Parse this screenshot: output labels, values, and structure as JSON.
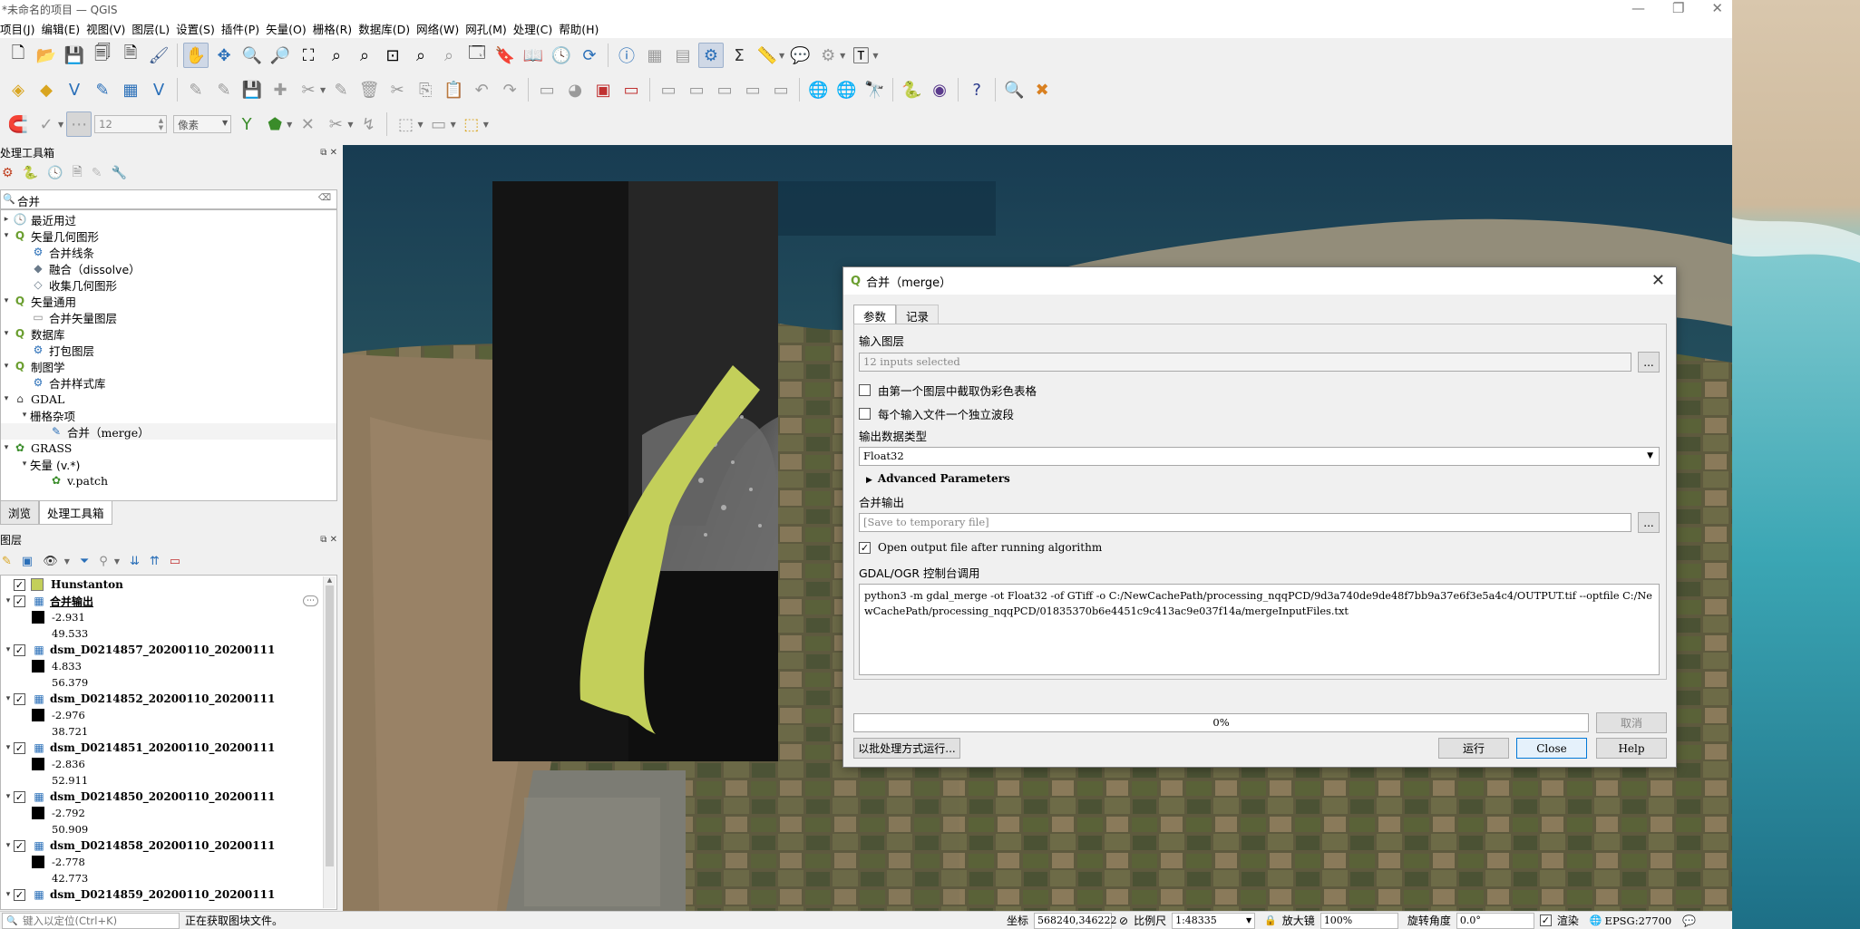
{
  "window": {
    "title": "*未命名的项目 — QGIS"
  },
  "menu": [
    "项目(J)",
    "编辑(E)",
    "视图(V)",
    "图层(L)",
    "设置(S)",
    "插件(P)",
    "矢量(O)",
    "栅格(R)",
    "数据库(D)",
    "网络(W)",
    "网孔(M)",
    "处理(C)",
    "帮助(H)"
  ],
  "digitize_toolbar": {
    "snap_value": "12",
    "snap_unit": "像素"
  },
  "toolbox": {
    "title": "处理工具箱",
    "search_value": "合并",
    "tree": [
      {
        "label": "最近用过",
        "level": 0,
        "icon": "clock-icon",
        "caret": "▸"
      },
      {
        "label": "矢量几何图形",
        "level": 0,
        "icon": "qgis-icon",
        "caret": "▾"
      },
      {
        "label": "合并线条",
        "level": 1,
        "icon": "gear-icon",
        "caret": ""
      },
      {
        "label": "融合（dissolve）",
        "level": 1,
        "icon": "dissolve-icon",
        "caret": ""
      },
      {
        "label": "收集几何图形",
        "level": 1,
        "icon": "collect-icon",
        "caret": ""
      },
      {
        "label": "矢量通用",
        "level": 0,
        "icon": "qgis-icon",
        "caret": "▾"
      },
      {
        "label": "合并矢量图层",
        "level": 1,
        "icon": "merge-vector-icon",
        "caret": ""
      },
      {
        "label": "数据库",
        "level": 0,
        "icon": "qgis-icon",
        "caret": "▾"
      },
      {
        "label": "打包图层",
        "level": 1,
        "icon": "gear-icon",
        "caret": ""
      },
      {
        "label": "制图学",
        "level": 0,
        "icon": "qgis-icon",
        "caret": "▾"
      },
      {
        "label": "合并样式库",
        "level": 1,
        "icon": "gear-icon",
        "caret": ""
      },
      {
        "label": "GDAL",
        "level": 0,
        "icon": "gdal-icon",
        "caret": "▾"
      },
      {
        "label": "栅格杂项",
        "level": 1,
        "icon": "",
        "caret": "▾"
      },
      {
        "label": "合并（merge）",
        "level": 2,
        "icon": "merge-raster-icon",
        "caret": ""
      },
      {
        "label": "GRASS",
        "level": 0,
        "icon": "grass-icon",
        "caret": "▾"
      },
      {
        "label": "矢量 (v.*)",
        "level": 1,
        "icon": "",
        "caret": "▾"
      },
      {
        "label": "v.patch",
        "level": 2,
        "icon": "grass-icon",
        "caret": ""
      }
    ],
    "tabs": [
      "浏览",
      "处理工具箱"
    ]
  },
  "layers": {
    "title": "图层",
    "items": [
      {
        "name": "Hunstanton",
        "type": "polygon",
        "color": "#c3cf5a",
        "underline": false
      },
      {
        "name": "合并输出",
        "type": "raster",
        "min": "-2.931",
        "max": "49.533",
        "underline": true
      },
      {
        "name": "dsm_D0214857_20200110_20200111",
        "type": "raster",
        "min": "4.833",
        "max": "56.379",
        "underline": false
      },
      {
        "name": "dsm_D0214852_20200110_20200111",
        "type": "raster",
        "min": "-2.976",
        "max": "38.721",
        "underline": false
      },
      {
        "name": "dsm_D0214851_20200110_20200111",
        "type": "raster",
        "min": "-2.836",
        "max": "52.911",
        "underline": false
      },
      {
        "name": "dsm_D0214850_20200110_20200111",
        "type": "raster",
        "min": "-2.792",
        "max": "50.909",
        "underline": false
      },
      {
        "name": "dsm_D0214858_20200110_20200111",
        "type": "raster",
        "min": "-2.778",
        "max": "42.773",
        "underline": false
      },
      {
        "name": "dsm_D0214859_20200110_20200111",
        "type": "raster",
        "min": "",
        "max": "",
        "underline": false
      }
    ]
  },
  "dialog": {
    "title": "合并（merge）",
    "tabs": [
      "参数",
      "记录"
    ],
    "input_layers_label": "输入图层",
    "input_layers_value": "12 inputs selected",
    "browse_label": "...",
    "chk_pct_label": "由第一个图层中截取伪彩色表格",
    "chk_separate_label": "每个输入文件一个独立波段",
    "data_type_label": "输出数据类型",
    "data_type_value": "Float32",
    "advanced_label": "Advanced Parameters",
    "output_label": "合并输出",
    "output_placeholder": "[Save to temporary file]",
    "browse2_label": "...",
    "open_output_label": "Open output file after running algorithm",
    "console_label": "GDAL/OGR 控制台调用",
    "console_text": "python3 -m gdal_merge -ot Float32 -of GTiff -o C:/NewCachePath/processing_nqqPCD/9d3a740de9de48f7bb9a37e6f3e5a4c4/OUTPUT.tif --optfile C:/NewCachePath/processing_nqqPCD/01835370b6e4451c9c413ac9e037f14a/mergeInputFiles.txt",
    "progress_value": 0,
    "progress_text": "0%",
    "cancel_label": "取消",
    "batch_label": "以批处理方式运行...",
    "run_label": "运行",
    "close_label": "Close",
    "help_label": "Help"
  },
  "status": {
    "locator_placeholder": "键入以定位(Ctrl+K)",
    "message": "正在获取图块文件。",
    "coord_label": "坐标",
    "coord_value": "568240,346222",
    "scale_label": "比例尺",
    "scale_value": "1:48335",
    "magnifier_label": "放大镜",
    "magnifier_value": "100%",
    "rotation_label": "旋转角度",
    "rotation_value": "0.0°",
    "render_label": "渲染",
    "crs": "EPSG:27700"
  }
}
